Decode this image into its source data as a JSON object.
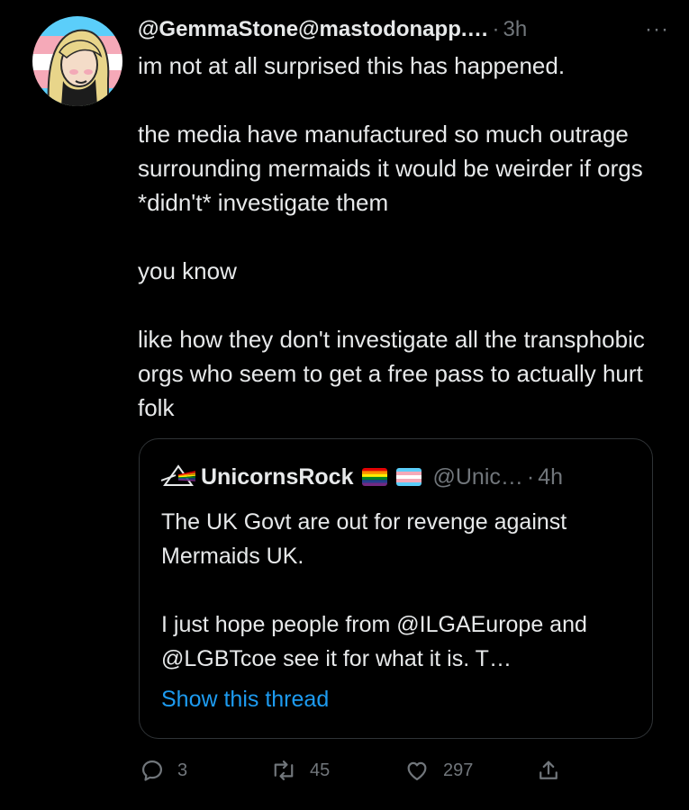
{
  "author": {
    "handle": "@GemmaStone@mastodonapp.…",
    "time": "3h",
    "more_icon": "more-icon"
  },
  "tweet": {
    "paragraphs": [
      "im not at all surprised this has happened.",
      "the media have manufactured so much outrage surrounding mermaids it would be weirder if orgs *didn't* investigate them",
      "you know",
      "like how they don't investigate all the transphobic orgs who seem to get a free pass to actually hurt folk"
    ]
  },
  "quote": {
    "name": "UnicornsRock",
    "handle": "@Unic…",
    "time": "4h",
    "paragraphs": [
      "The UK Govt are out for revenge against Mermaids UK.",
      "I just hope people from @ILGAEurope and @LGBTcoe see it for what it is. T…"
    ],
    "show_thread": "Show this thread"
  },
  "actions": {
    "replies": "3",
    "retweets": "45",
    "likes": "297"
  },
  "colors": {
    "background": "#000000",
    "text": "#e7e9ea",
    "muted": "#71767b",
    "link": "#1d9bf0",
    "border": "#2f3336"
  }
}
